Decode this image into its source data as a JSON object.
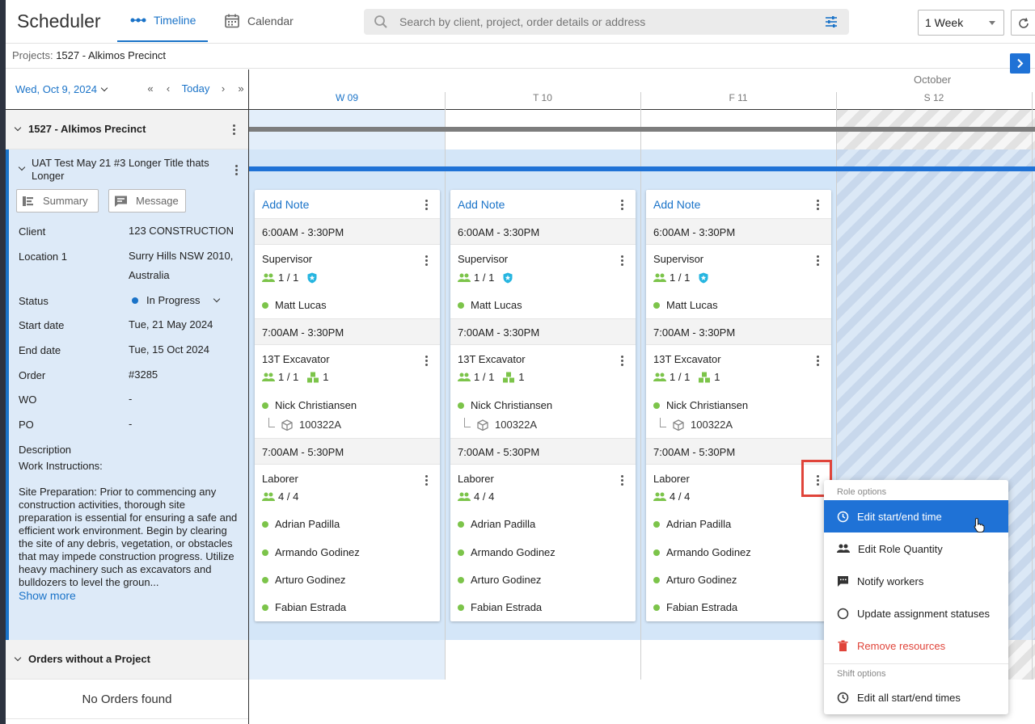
{
  "app": {
    "title": "Scheduler"
  },
  "tabs": [
    {
      "label": "Timeline"
    },
    {
      "label": "Calendar"
    }
  ],
  "search": {
    "placeholder": "Search by client, project, order details or address"
  },
  "range": {
    "selected": "1 Week"
  },
  "projects_bar": {
    "label": "Projects:",
    "value": "1527 - Alkimos Precinct"
  },
  "date_nav": {
    "date": "Wed, Oct 9, 2024",
    "first": "«",
    "prev": "‹",
    "today": "Today",
    "next": "›",
    "last": "»"
  },
  "timeline": {
    "month": "October",
    "days": [
      {
        "label": "W 09"
      },
      {
        "label": "T 10"
      },
      {
        "label": "F 11"
      },
      {
        "label": "S 12"
      }
    ]
  },
  "project": {
    "title": "1527 - Alkimos Precinct"
  },
  "order": {
    "title": "UAT Test May 21 #3 Longer Title thats Longer",
    "buttons": {
      "summary": "Summary",
      "message": "Message"
    },
    "fields": [
      {
        "key": "Client",
        "value": "123 CONSTRUCTION"
      },
      {
        "key": "Location 1",
        "value": "Surry Hills NSW 2010, Australia"
      },
      {
        "key": "Status",
        "value": "In Progress"
      },
      {
        "key": "Start date",
        "value": "Tue, 21 May 2024"
      },
      {
        "key": "End date",
        "value": "Tue, 15 Oct 2024"
      },
      {
        "key": "Order",
        "value": "#3285"
      },
      {
        "key": "WO",
        "value": "-"
      },
      {
        "key": "PO",
        "value": "-"
      }
    ],
    "description_label": "Description",
    "description_line1": "Work Instructions:",
    "description_text": "Site Preparation: Prior to commencing any construction activities, thorough site preparation is essential for ensuring a safe and efficient work environment. Begin by clearing the site of any debris, vegetation, or obstacles that may impede construction progress. Utilize heavy machinery such as excavators and bulldozers to level the groun...",
    "show_more": "Show more"
  },
  "orders_without_project": {
    "title": "Orders without a Project",
    "empty": "No Orders found"
  },
  "card": {
    "add_note": "Add Note",
    "shifts": [
      {
        "time": "6:00AM - 3:30PM",
        "role": "Supervisor",
        "qty": "1 / 1",
        "workers": [
          "Matt Lucas"
        ]
      },
      {
        "time": "7:00AM - 3:30PM",
        "role": "13T Excavator",
        "qty": "1 / 1",
        "equip_qty": "1",
        "workers": [
          "Nick Christiansen"
        ],
        "asset": "100322A"
      },
      {
        "time": "7:00AM - 5:30PM",
        "role": "Laborer",
        "qty": "4 / 4",
        "workers": [
          "Adrian Padilla",
          "Armando Godinez",
          "Arturo Godinez",
          "Fabian Estrada"
        ]
      }
    ]
  },
  "menu": {
    "role_section": "Role options",
    "role_items": [
      {
        "label": "Edit start/end time",
        "icon": "clock-icon"
      },
      {
        "label": "Edit Role Quantity",
        "icon": "people-icon"
      },
      {
        "label": "Notify workers",
        "icon": "chat-icon"
      },
      {
        "label": "Update assignment statuses",
        "icon": "circle-icon"
      },
      {
        "label": "Remove resources",
        "icon": "trash-icon"
      }
    ],
    "shift_section": "Shift options",
    "shift_items": [
      {
        "label": "Edit all start/end times",
        "icon": "clock-icon"
      }
    ]
  },
  "colors": {
    "accent": "#1f72d6",
    "success": "#7cc44a",
    "danger": "#e0443a",
    "highlight_panel": "#ddeaf8"
  }
}
